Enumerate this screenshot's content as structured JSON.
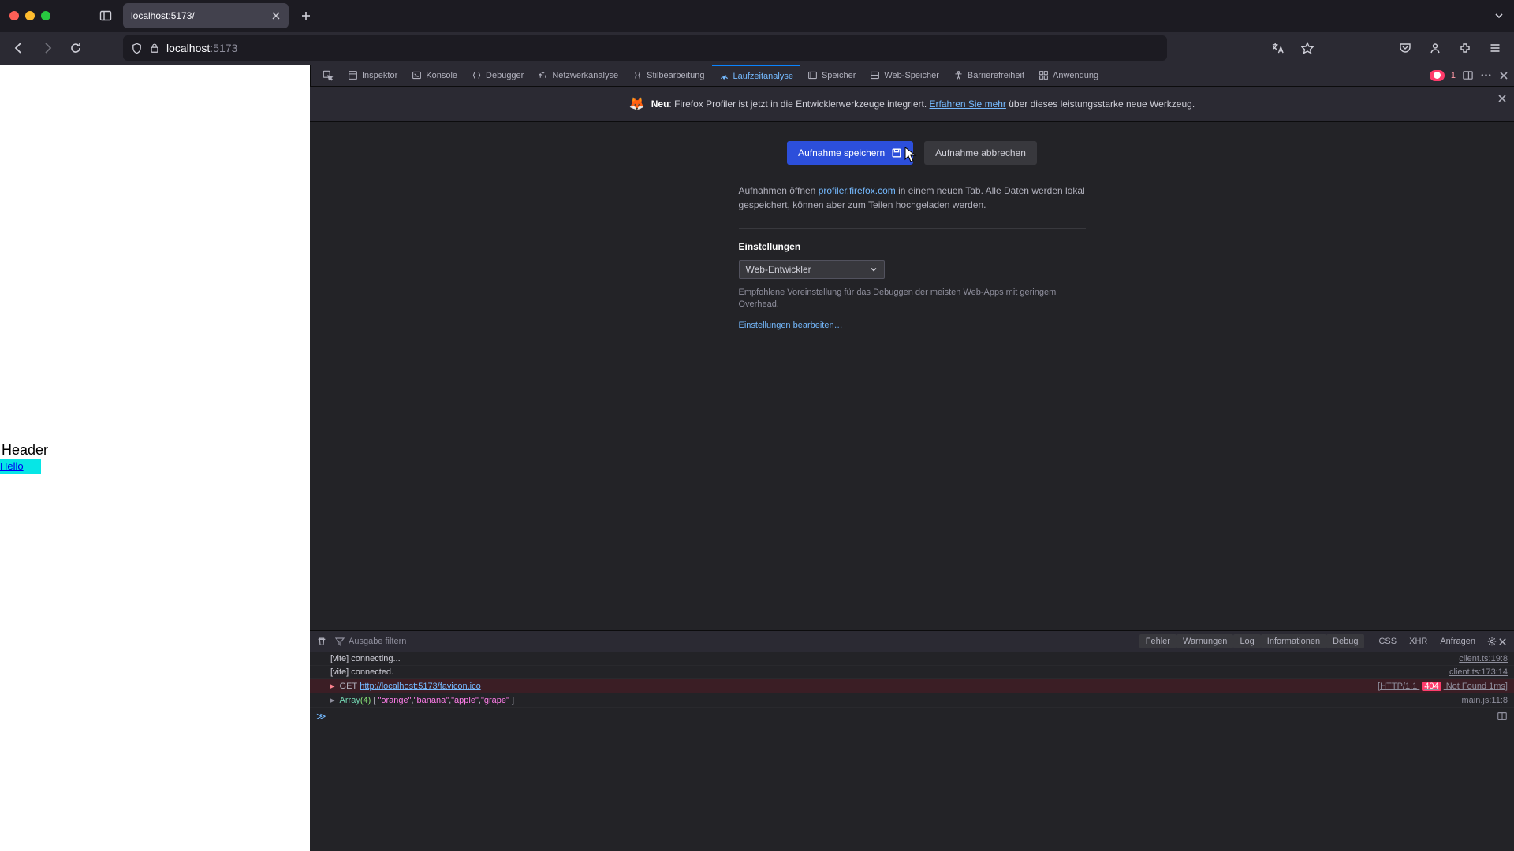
{
  "titlebar": {
    "tab_label": "localhost:5173/"
  },
  "navbar": {
    "url_host": "localhost",
    "url_port": ":5173"
  },
  "devtools_tabs": {
    "picker": "",
    "inspector": "Inspektor",
    "console": "Konsole",
    "debugger": "Debugger",
    "network": "Netzwerkanalyse",
    "style": "Stilbearbeitung",
    "performance": "Laufzeitanalyse",
    "memory": "Speicher",
    "storage": "Web-Speicher",
    "accessibility": "Barrierefreiheit",
    "application": "Anwendung",
    "error_count": "1"
  },
  "page": {
    "header": "Header",
    "link": "Hello"
  },
  "notice": {
    "new": "Neu",
    "text1": ": Firefox Profiler ist jetzt in die Entwicklerwerkzeuge integriert. ",
    "link": "Erfahren Sie mehr",
    "text2": " über dieses leistungsstarke neue Werkzeug."
  },
  "profiler": {
    "save_btn": "Aufnahme speichern",
    "cancel_btn": "Aufnahme abbrechen",
    "desc_prefix": "Aufnahmen öffnen ",
    "desc_link": "profiler.firefox.com",
    "desc_suffix": " in einem neuen Tab. Alle Daten werden lokal gespeichert, können aber zum Teilen hochgeladen werden.",
    "settings_title": "Einstellungen",
    "preset": "Web-Entwickler",
    "preset_hint": "Empfohlene Voreinstellung für das Debuggen der meisten Web-Apps mit geringem Overhead.",
    "edit_link": "Einstellungen bearbeiten…"
  },
  "console": {
    "filter_placeholder": "Ausgabe filtern",
    "filters": {
      "errors": "Fehler",
      "warnings": "Warnungen",
      "log": "Log",
      "info": "Informationen",
      "debug": "Debug",
      "css": "CSS",
      "xhr": "XHR",
      "requests": "Anfragen"
    },
    "rows": {
      "r0_text": "[vite] connecting...",
      "r0_loc": "client.ts:19:8",
      "r1_text": "[vite] connected.",
      "r1_loc": "client.ts:173:14",
      "r2_method": "GET",
      "r2_url": "http://localhost:5173/favicon.ico",
      "r2_status_prefix": "[HTTP/1.1 ",
      "r2_status_code": "404",
      "r2_status_suffix": " Not Found 1ms]",
      "r3_array": "Array",
      "r3_len": "(4)",
      "r3_items": "[ \"orange\", \"banana\", \"apple\", \"grape\" ]",
      "r3_loc": "main.js:11:8"
    }
  }
}
